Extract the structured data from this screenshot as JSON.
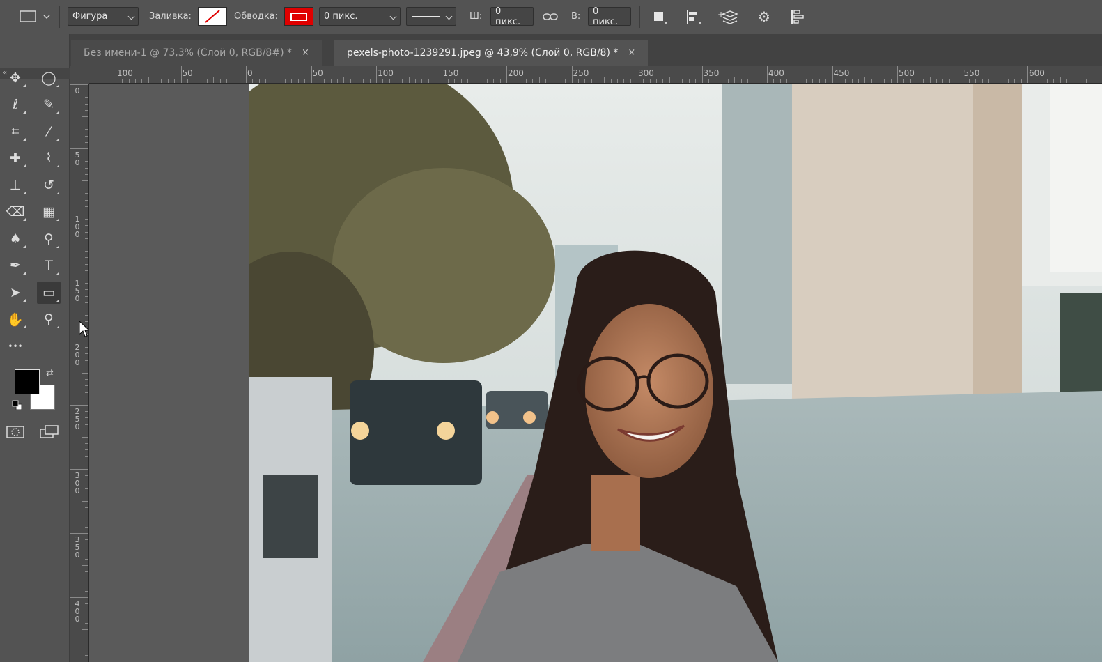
{
  "options_bar": {
    "shape_mode": "Фигура",
    "fill_label": "Заливка:",
    "stroke_label": "Обводка:",
    "stroke_width": "0 пикс.",
    "width_label": "Ш:",
    "width_value": "0 пикс.",
    "height_label": "В:",
    "height_value": "0 пикс.",
    "stroke_color": "#e00000"
  },
  "tabs": [
    {
      "label": "Без имени-1 @ 73,3% (Слой 0, RGB/8#) *",
      "close": "×",
      "active": false
    },
    {
      "label": "pexels-photo-1239291.jpeg @ 43,9% (Слой 0, RGB/8) *",
      "close": "×",
      "active": true
    }
  ],
  "ruler_h": [
    "100",
    "50",
    "0",
    "50",
    "100",
    "150",
    "200",
    "250",
    "300",
    "350",
    "400",
    "450",
    "500",
    "550",
    "600"
  ],
  "ruler_v": [
    "0",
    "50",
    "100",
    "150",
    "200",
    "250",
    "300",
    "350",
    "400"
  ],
  "tools": [
    {
      "name": "move-tool",
      "glyph": "✥"
    },
    {
      "name": "ellipse-marquee-tool",
      "glyph": "◯"
    },
    {
      "name": "lasso-tool",
      "glyph": "ℓ"
    },
    {
      "name": "quick-selection-tool",
      "glyph": "✎"
    },
    {
      "name": "crop-tool",
      "glyph": "⌗"
    },
    {
      "name": "eyedropper-tool",
      "glyph": "⁄"
    },
    {
      "name": "healing-brush-tool",
      "glyph": "✚"
    },
    {
      "name": "brush-tool",
      "glyph": "⌇"
    },
    {
      "name": "clone-stamp-tool",
      "glyph": "⊥"
    },
    {
      "name": "history-brush-tool",
      "glyph": "↺"
    },
    {
      "name": "eraser-tool",
      "glyph": "⌫"
    },
    {
      "name": "gradient-tool",
      "glyph": "▦"
    },
    {
      "name": "blur-tool",
      "glyph": "♠"
    },
    {
      "name": "dodge-tool",
      "glyph": "⚲"
    },
    {
      "name": "pen-tool",
      "glyph": "✒"
    },
    {
      "name": "type-tool",
      "glyph": "T"
    },
    {
      "name": "path-selection-tool",
      "glyph": "➤"
    },
    {
      "name": "rectangle-tool",
      "glyph": "▭"
    },
    {
      "name": "hand-tool",
      "glyph": "✋"
    },
    {
      "name": "zoom-tool",
      "glyph": "⚲"
    },
    {
      "name": "edit-toolbar",
      "glyph": "•••"
    }
  ],
  "colors": {
    "foreground": "#000000",
    "background": "#ffffff"
  }
}
